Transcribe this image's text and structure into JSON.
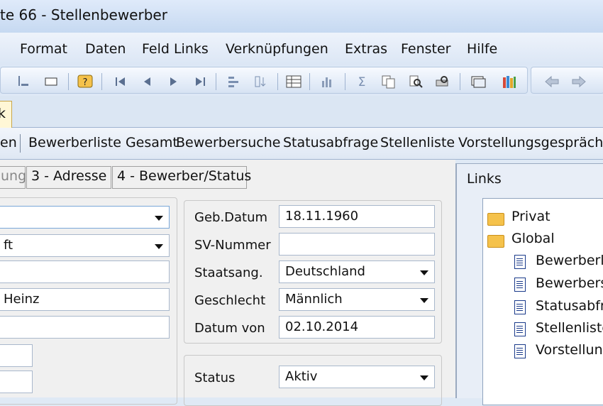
{
  "window": {
    "title": "te 66 - Stellenbewerber"
  },
  "menu": [
    "Format",
    "Daten",
    "Feld Links",
    "Verknüpfungen",
    "Extras",
    "Fenster",
    "Hilfe"
  ],
  "toolbar_icons": [
    "record-icon",
    "frame-icon",
    "help-icon",
    "first-record-icon",
    "prev-record-icon",
    "next-record-icon",
    "last-record-icon",
    "insert-icon",
    "sort-icon",
    "table-icon",
    "chart-icon",
    "sum-icon",
    "copy-icon",
    "find-icon",
    "preview-icon",
    "window-icon",
    "books-icon",
    "back-arrow-icon",
    "forward-arrow-icon"
  ],
  "active_tab": {
    "label": "k"
  },
  "links_bar": [
    "en",
    "Bewerberliste Gesamt",
    "Bewerbersuche",
    "Statusabfrage",
    "Stellenliste",
    "Vorstellungsgespräche"
  ],
  "form_tabs": [
    {
      "label": "ung"
    },
    {
      "label": "3 - Adresse"
    },
    {
      "label": "4 - Bewerber/Status"
    }
  ],
  "left_fields": {
    "f1": "",
    "f2": "ft",
    "f3": "",
    "f4": "Heinz",
    "f5": "",
    "f6": "",
    "f7": ""
  },
  "right_fields": {
    "geb_label": "Geb.Datum",
    "geb_value": "18.11.1960",
    "sv_label": "SV-Nummer",
    "sv_value": "",
    "staat_label": "Staatsang.",
    "staat_value": "Deutschland",
    "geschlecht_label": "Geschlecht",
    "geschlecht_value": "Männlich",
    "datum_label": "Datum von",
    "datum_value": "02.10.2014",
    "status_label": "Status",
    "status_value": "Aktiv"
  },
  "links_panel": {
    "title": "Links",
    "folders": [
      "Privat",
      "Global"
    ],
    "items": [
      "Bewerberlis",
      "Bewerbersu",
      "Statusabfra",
      "Stellenliste",
      "Vorstellung"
    ]
  },
  "colors": {
    "accent": "#c6d9f1",
    "tab_active": "#fff7d6",
    "folder": "#f5c24b"
  }
}
